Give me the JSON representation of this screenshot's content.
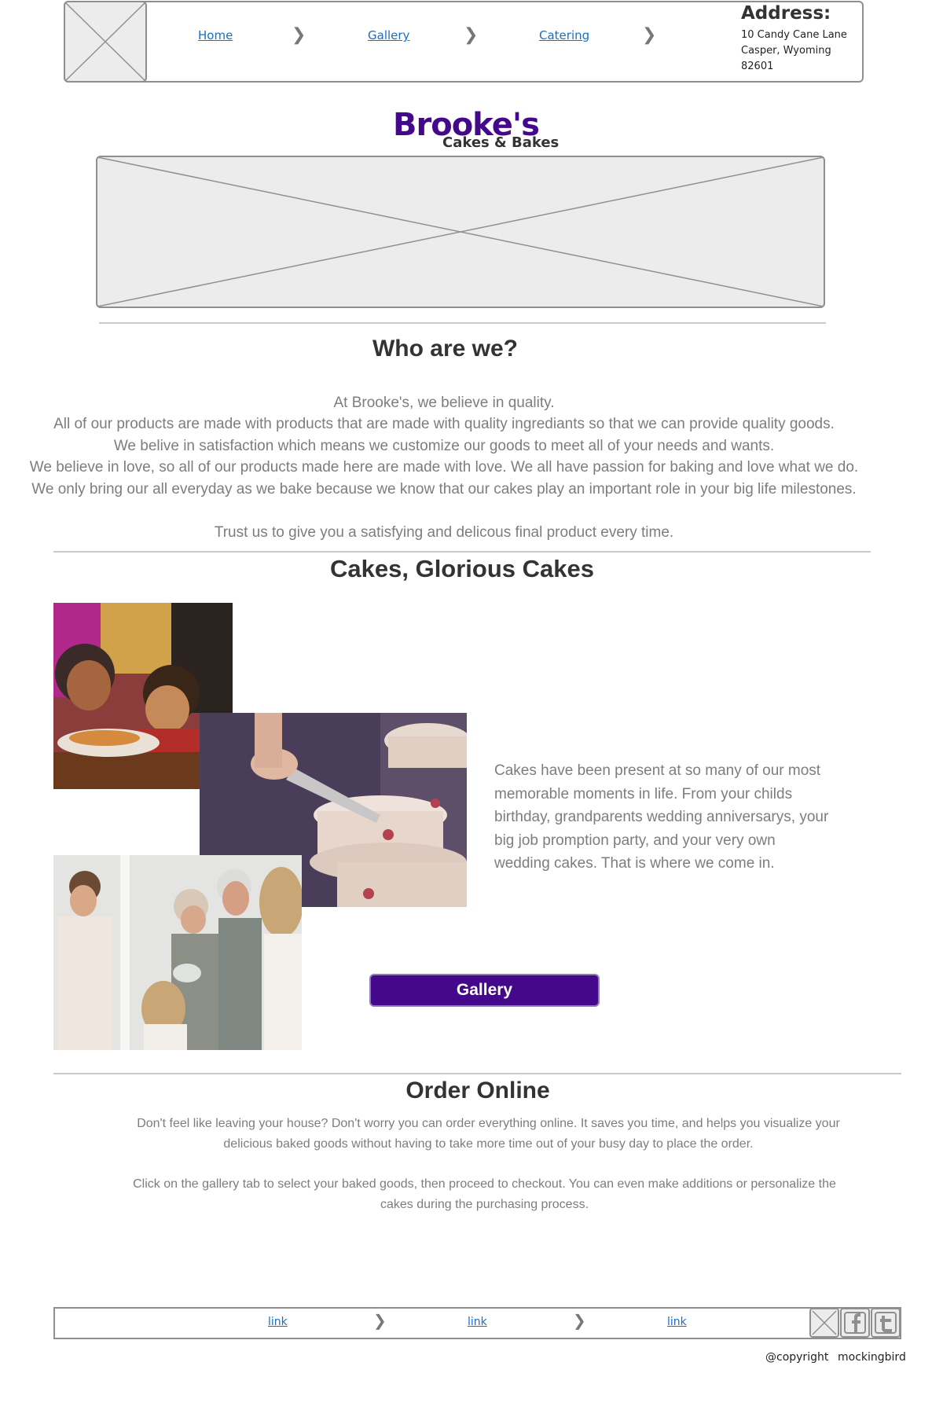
{
  "nav": {
    "links": [
      "Home",
      "Gallery",
      "Catering"
    ],
    "address_title": "Address:",
    "address_lines": [
      "10 Candy Cane Lane",
      "Casper, Wyoming",
      "82601"
    ]
  },
  "brand": {
    "name": "Brooke's",
    "tagline": "Cakes & Bakes"
  },
  "about": {
    "heading": "Who are we?",
    "lines": [
      "At Brooke's, we believe in quality.",
      "All of our products are made with products that are made with quality ingrediants so that we can provide quality goods.",
      "We belive in satisfaction which means we customize our goods to meet all of your needs and wants.",
      "We believe in love, so all of our products made here are made with love. We all have passion for baking and love what we do.",
      "We only bring our all everyday as we bake because we know that our cakes play an important role in your big life milestones.",
      "Trust us to give you a satisfying and delicous final product every time."
    ]
  },
  "cakes": {
    "heading": "Cakes, Glorious Cakes",
    "text": "Cakes have been present at so many of our most memorable moments in life. From your childs birthday, grandparents wedding anniversarys, your big job promption party, and your very own wedding cakes. That is where we come in.",
    "button_label": "Gallery"
  },
  "order": {
    "heading": "Order Online",
    "para1": "Don't feel like leaving your house? Don't worry you can order everything online. It saves you time, and helps you visualize your delicious baked goods without having to take more time out of your busy day to place the order.",
    "para2": "Click on the gallery tab to select your baked goods, then proceed to checkout. You can even make additions or personalize the cakes during the purchasing process."
  },
  "footer": {
    "links": [
      "link",
      "link",
      "link"
    ],
    "copyright": "@copyright",
    "credit": "mockingbird",
    "social_icons": [
      "image-placeholder-icon",
      "facebook-icon",
      "twitter-icon"
    ]
  },
  "colors": {
    "brand": "#44088a",
    "link": "#1a6fc4",
    "muted_text": "#7d7d7d"
  }
}
